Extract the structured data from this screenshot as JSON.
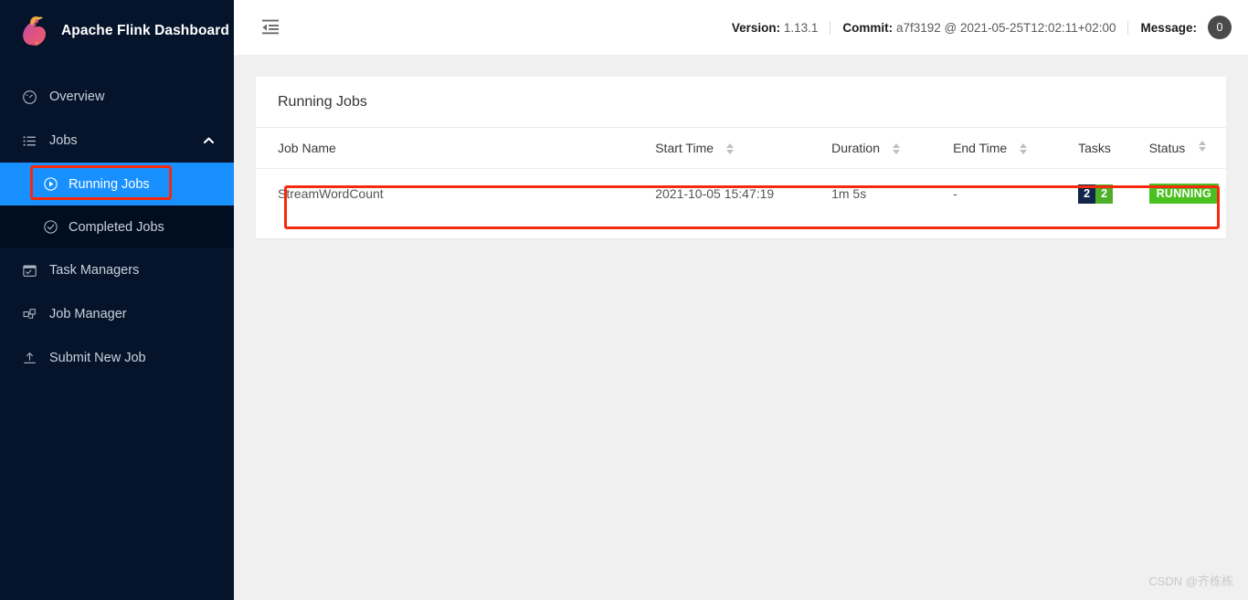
{
  "brand": {
    "title": "Apache Flink Dashboard",
    "logo_icon": "flink-squirrel-logo"
  },
  "sidebar": {
    "items": [
      {
        "label": "Overview",
        "icon": "dashboard-gauge-icon"
      },
      {
        "label": "Jobs",
        "icon": "list-icon",
        "chevron": "chevron-up-icon",
        "expanded": true
      },
      {
        "label": "Task Managers",
        "icon": "task-managers-icon"
      },
      {
        "label": "Job Manager",
        "icon": "job-manager-icon"
      },
      {
        "label": "Submit New Job",
        "icon": "upload-icon"
      }
    ],
    "sub_items": [
      {
        "label": "Running Jobs",
        "icon": "play-circle-icon",
        "active": true
      },
      {
        "label": "Completed Jobs",
        "icon": "check-circle-icon",
        "active": false
      }
    ]
  },
  "topbar": {
    "fold_icon": "menu-fold-icon",
    "version_label": "Version:",
    "version_value": "1.13.1",
    "commit_label": "Commit:",
    "commit_value": "a7f3192 @ 2021-05-25T12:02:11+02:00",
    "message_label": "Message:",
    "message_count": "0"
  },
  "card": {
    "title": "Running Jobs",
    "columns": [
      {
        "label": "Job Name",
        "sortable": false
      },
      {
        "label": "Start Time",
        "sortable": true
      },
      {
        "label": "Duration",
        "sortable": true
      },
      {
        "label": "End Time",
        "sortable": true
      },
      {
        "label": "Tasks",
        "sortable": false
      },
      {
        "label": "Status",
        "sortable": true
      }
    ],
    "rows": [
      {
        "job_name": "StreamWordCount",
        "start_time": "2021-10-05 15:47:19",
        "duration": "1m 5s",
        "end_time": "-",
        "tasks_total": "2",
        "tasks_running": "2",
        "status": "RUNNING"
      }
    ]
  },
  "annotations": {
    "highlight_color": "#f42a0d"
  },
  "watermark": "CSDN @齐栋栋"
}
